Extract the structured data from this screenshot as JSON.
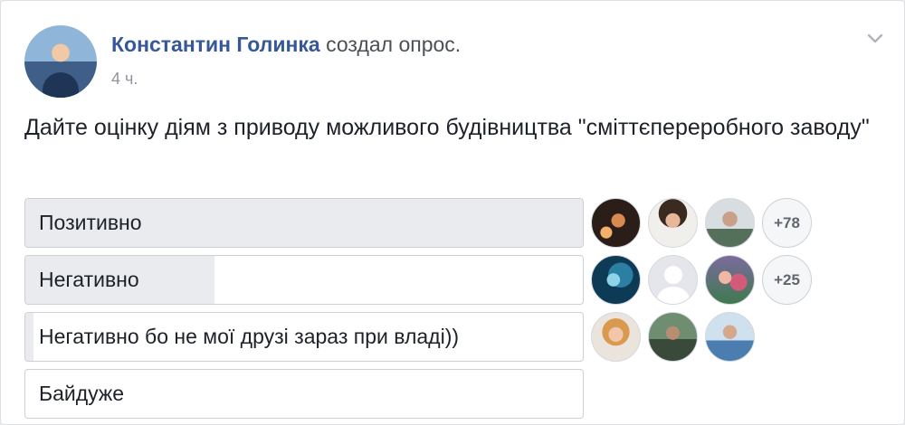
{
  "post": {
    "author": "Константин Голинка",
    "action": "создал опрос.",
    "time": "4 ч.",
    "question": "Дайте оцінку діям з приводу можливого будівництва \"сміттєпереробного заводу\""
  },
  "poll": {
    "options": [
      {
        "label": "Позитивно",
        "fill_fraction": 1.0,
        "more": "+78",
        "voters": [
          "voter-photo",
          "voter-photo",
          "voter-photo"
        ]
      },
      {
        "label": "Негативно",
        "fill_fraction": 0.34,
        "more": "+25",
        "voters": [
          "voter-photo",
          "voter-default-silhouette",
          "voter-photo"
        ]
      },
      {
        "label": "Негативно бо не мої друзі зараз при владі))",
        "fill_fraction": 0.015,
        "more": "",
        "voters": [
          "voter-photo",
          "voter-photo",
          "voter-photo"
        ]
      },
      {
        "label": "Байдуже",
        "fill_fraction": 0.0,
        "more": "",
        "voters": []
      }
    ]
  },
  "colors": {
    "author_link": "#365899",
    "bar_fill": "#e9ebee",
    "border": "#ccd0d5"
  },
  "icons": {
    "menu": "chevron-down-icon"
  }
}
